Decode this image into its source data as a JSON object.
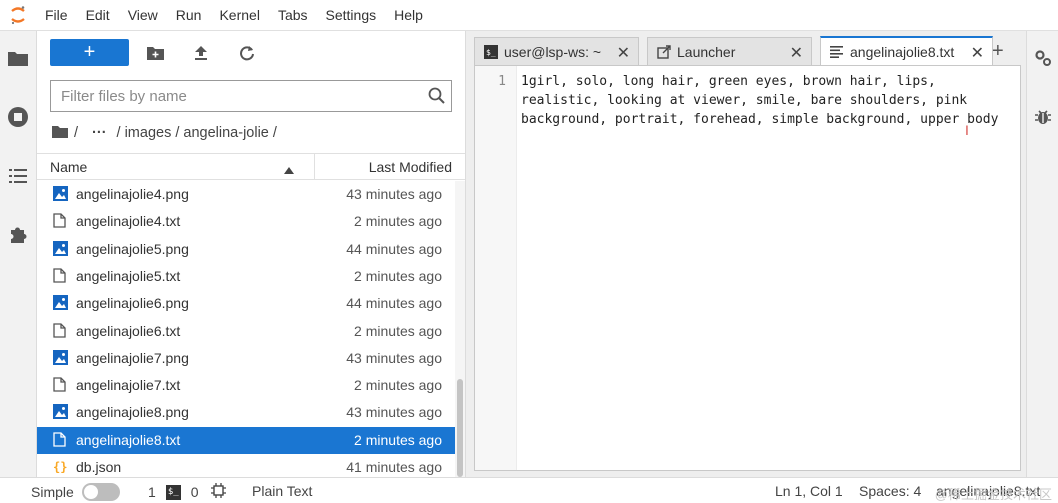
{
  "menu": [
    "File",
    "Edit",
    "View",
    "Run",
    "Kernel",
    "Tabs",
    "Settings",
    "Help"
  ],
  "filebrowser": {
    "new_label": "+",
    "filter_placeholder": "Filter files by name",
    "breadcrumbs": [
      "/",
      "···",
      "/ images / angelina-jolie /"
    ],
    "col_name": "Name",
    "col_modified": "Last Modified",
    "files": [
      {
        "name": "angelinajolie4.png",
        "modified": "43 minutes ago",
        "kind": "image"
      },
      {
        "name": "angelinajolie4.txt",
        "modified": "2 minutes ago",
        "kind": "text"
      },
      {
        "name": "angelinajolie5.png",
        "modified": "44 minutes ago",
        "kind": "image"
      },
      {
        "name": "angelinajolie5.txt",
        "modified": "2 minutes ago",
        "kind": "text"
      },
      {
        "name": "angelinajolie6.png",
        "modified": "44 minutes ago",
        "kind": "image"
      },
      {
        "name": "angelinajolie6.txt",
        "modified": "2 minutes ago",
        "kind": "text"
      },
      {
        "name": "angelinajolie7.png",
        "modified": "43 minutes ago",
        "kind": "image"
      },
      {
        "name": "angelinajolie7.txt",
        "modified": "2 minutes ago",
        "kind": "text"
      },
      {
        "name": "angelinajolie8.png",
        "modified": "43 minutes ago",
        "kind": "image"
      },
      {
        "name": "angelinajolie8.txt",
        "modified": "2 minutes ago",
        "kind": "text",
        "selected": true
      },
      {
        "name": "db.json",
        "modified": "41 minutes ago",
        "kind": "json"
      }
    ]
  },
  "tabs": [
    {
      "label": "user@lsp-ws: ~",
      "icon": "terminal-icon"
    },
    {
      "label": "Launcher",
      "icon": "launcher-icon"
    },
    {
      "label": "angelinajolie8.txt",
      "icon": "text-file-icon",
      "active": true
    }
  ],
  "editor": {
    "line_number": "1",
    "lines": [
      "1girl, solo, long hair, green eyes, brown hair, lips,",
      "realistic, looking at viewer, smile, bare shoulders, pink",
      "background, portrait, forehead, simple background, upper body"
    ]
  },
  "status": {
    "mode_label": "Simple",
    "kernels_count": "1",
    "terminals_count": "0",
    "language": "Plain Text",
    "position": "Ln 1, Col 1",
    "spaces": "Spaces: 4",
    "filename": "angelinajolie8.txt",
    "watermark": "@稀土掘金技术社区"
  },
  "colors": {
    "accent": "#1976d2",
    "logo_orange": "#f37726",
    "image_icon": "#1565c0",
    "json_icon": "#f9a825"
  }
}
